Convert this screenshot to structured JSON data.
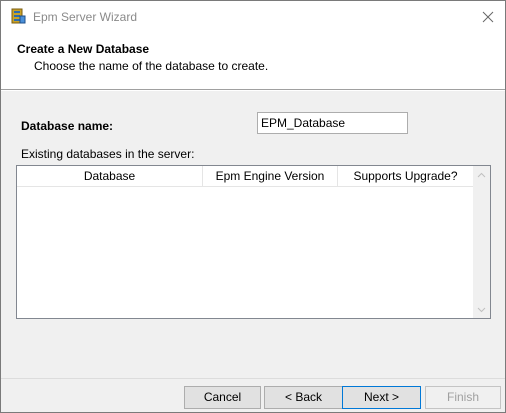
{
  "window": {
    "title": "Epm Server Wizard",
    "close_icon": "close-icon"
  },
  "header": {
    "title": "Create a New Database",
    "subtitle": "Choose the name of the database to create."
  },
  "form": {
    "db_name_label": "Database name:",
    "db_name_value": "EPM_Database",
    "existing_label": "Existing databases in the server:"
  },
  "listview": {
    "columns": [
      "Database",
      "Epm Engine Version",
      "Supports Upgrade?"
    ],
    "rows": []
  },
  "buttons": {
    "cancel": "Cancel",
    "back": "< Back",
    "next": "Next >",
    "finish": "Finish"
  }
}
